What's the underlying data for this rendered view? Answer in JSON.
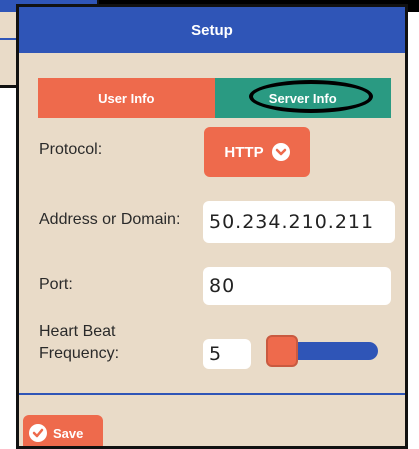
{
  "dialog": {
    "title": "Setup"
  },
  "tabs": [
    {
      "label": "User Info"
    },
    {
      "label": "Server Info"
    }
  ],
  "form": {
    "protocol_label": "Protocol:",
    "protocol_value": "HTTP",
    "address_label": "Address or Domain:",
    "address_value": "50.234.210.211",
    "port_label": "Port:",
    "port_value": "80",
    "heartbeat_label_line1": "Heart Beat",
    "heartbeat_label_line2": "Frequency:",
    "heartbeat_value": "5"
  },
  "footer": {
    "save_label": "Save"
  },
  "icons": {
    "protocol_dropdown": "chevron-down-icon",
    "save": "checkmark-icon"
  },
  "colors": {
    "title_bar": "#2f55b7",
    "accent": "#ee6a4c",
    "tab_active": "#2a9a82",
    "panel": "#e9dbc8"
  }
}
